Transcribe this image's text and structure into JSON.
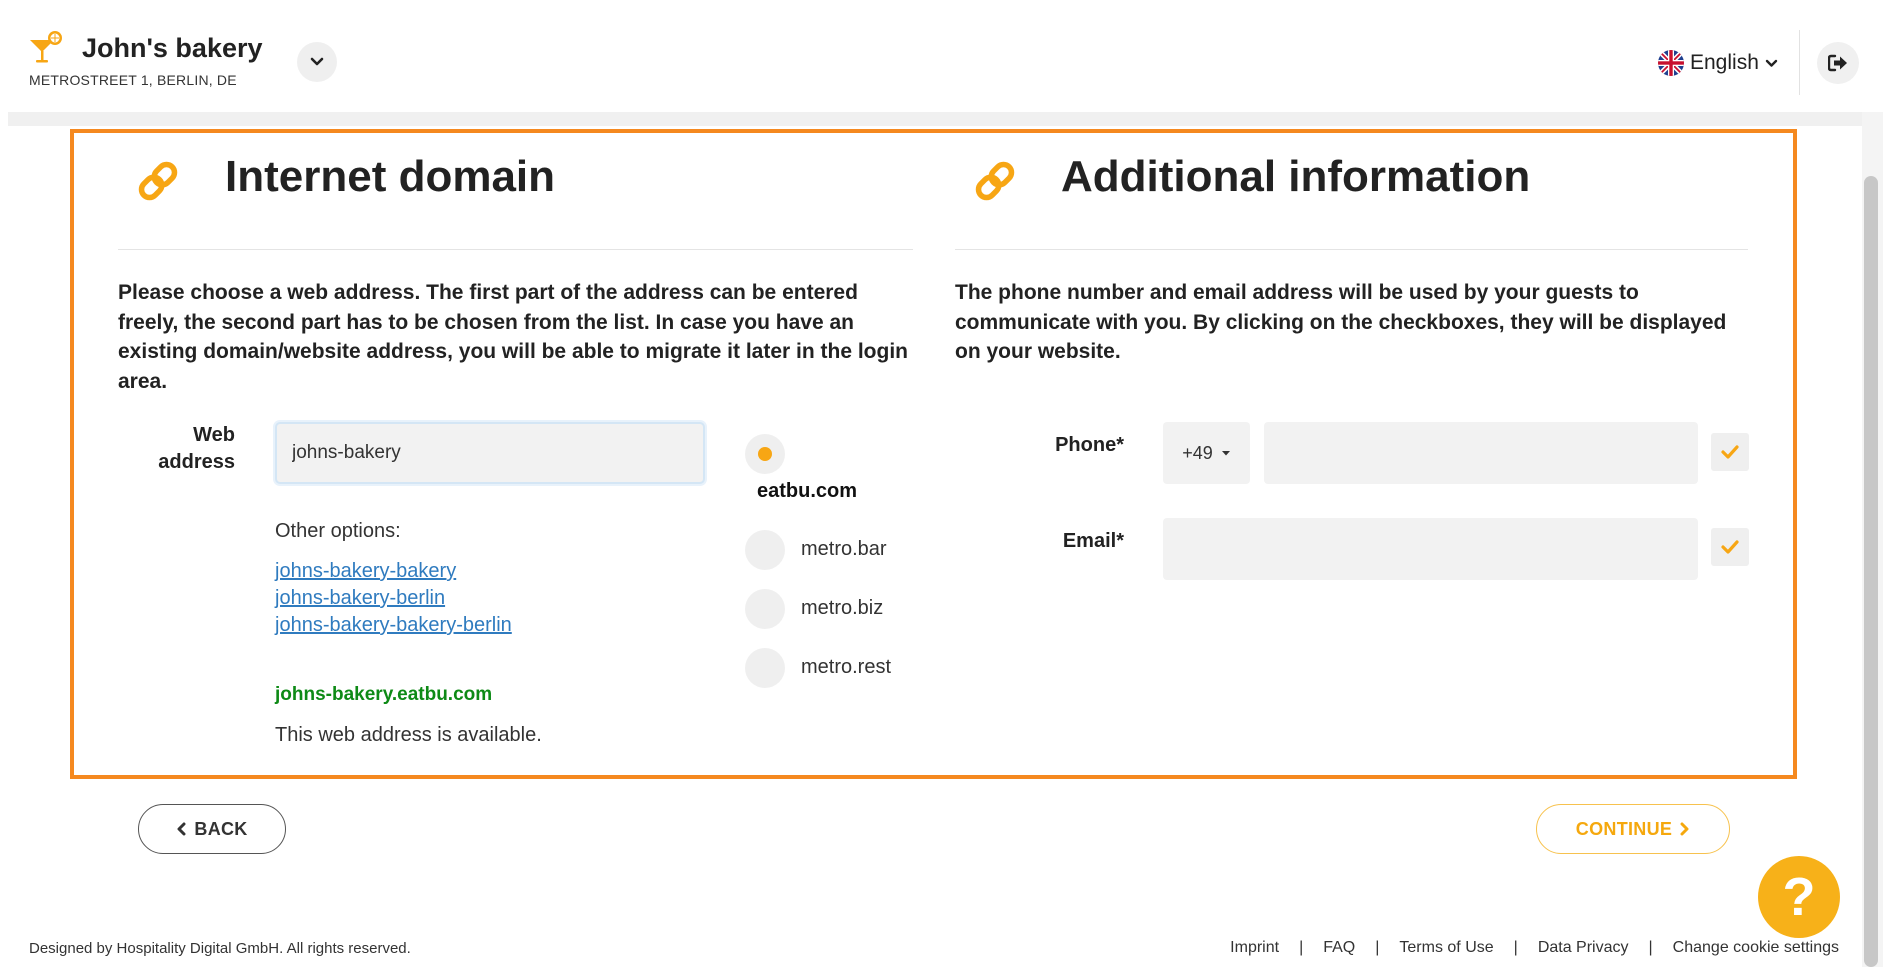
{
  "header": {
    "business_name": "John's bakery",
    "business_address": "METROSTREET 1, BERLIN, DE",
    "language": "English"
  },
  "domain_section": {
    "title": "Internet domain",
    "description": "Please choose a web address. The first part of the address can be entered freely, the second part has to be chosen from the list. In case you have an existing domain/website address, you will be able to migrate it later in the login area.",
    "web_address_label": "Web address",
    "web_address_value": "johns-bakery",
    "other_options_label": "Other options:",
    "options": [
      "johns-bakery-bakery",
      "johns-bakery-berlin",
      "johns-bakery-bakery-berlin"
    ],
    "available_domain": "johns-bakery.eatbu.com",
    "available_text": "This web address is available.",
    "domain_choices": [
      {
        "label": "eatbu.com",
        "selected": true
      },
      {
        "label": "metro.bar",
        "selected": false
      },
      {
        "label": "metro.biz",
        "selected": false
      },
      {
        "label": "metro.rest",
        "selected": false
      }
    ]
  },
  "info_section": {
    "title": "Additional information",
    "description": "The phone number and email address will be used by your guests to communicate with you. By clicking on the checkboxes, they will be displayed on your website.",
    "phone_label": "Phone*",
    "phone_code": "+49",
    "phone_value": "",
    "email_label": "Email*",
    "email_value": ""
  },
  "nav": {
    "back_label": "BACK",
    "continue_label": "CONTINUE"
  },
  "help": {
    "label": "?"
  },
  "footer": {
    "copyright": "Designed by Hospitality Digital GmbH. All rights reserved.",
    "links": [
      "Imprint",
      "FAQ",
      "Terms of Use",
      "Data Privacy",
      "Change cookie settings"
    ]
  },
  "colors": {
    "accent": "#f7a614",
    "highlight_border": "#f5891f",
    "success": "#0e8a16",
    "link": "#2f7bbf"
  }
}
